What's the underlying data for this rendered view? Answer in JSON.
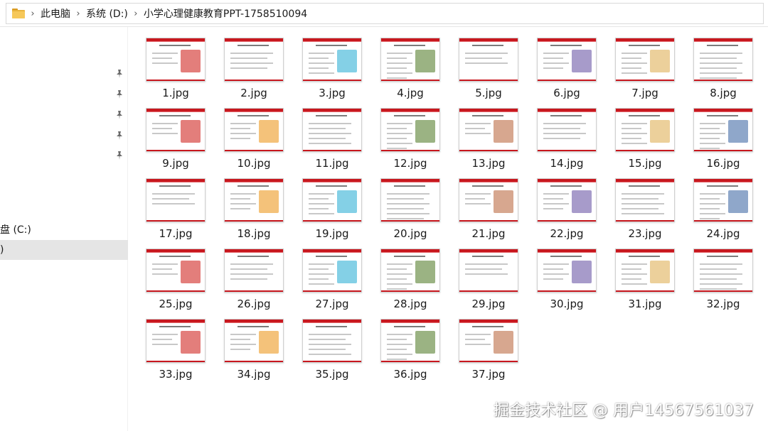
{
  "address_bar": {
    "crumbs": [
      "此电脑",
      "系统 (D:)",
      "小学心理健康教育PPT-1758510094"
    ]
  },
  "sidebar": {
    "drives": [
      {
        "label": "盘 (C:)",
        "selected": false
      },
      {
        "label": ")",
        "selected": true
      }
    ]
  },
  "files": [
    {
      "name": "1.jpg"
    },
    {
      "name": "2.jpg"
    },
    {
      "name": "3.jpg"
    },
    {
      "name": "4.jpg"
    },
    {
      "name": "5.jpg"
    },
    {
      "name": "6.jpg"
    },
    {
      "name": "7.jpg"
    },
    {
      "name": "8.jpg"
    },
    {
      "name": "9.jpg"
    },
    {
      "name": "10.jpg"
    },
    {
      "name": "11.jpg"
    },
    {
      "name": "12.jpg"
    },
    {
      "name": "13.jpg"
    },
    {
      "name": "14.jpg"
    },
    {
      "name": "15.jpg"
    },
    {
      "name": "16.jpg"
    },
    {
      "name": "17.jpg"
    },
    {
      "name": "18.jpg"
    },
    {
      "name": "19.jpg"
    },
    {
      "name": "20.jpg"
    },
    {
      "name": "21.jpg"
    },
    {
      "name": "22.jpg"
    },
    {
      "name": "23.jpg"
    },
    {
      "name": "24.jpg"
    },
    {
      "name": "25.jpg"
    },
    {
      "name": "26.jpg"
    },
    {
      "name": "27.jpg"
    },
    {
      "name": "28.jpg"
    },
    {
      "name": "29.jpg"
    },
    {
      "name": "30.jpg"
    },
    {
      "name": "31.jpg"
    },
    {
      "name": "32.jpg"
    },
    {
      "name": "33.jpg"
    },
    {
      "name": "34.jpg"
    },
    {
      "name": "35.jpg"
    },
    {
      "name": "36.jpg"
    },
    {
      "name": "37.jpg"
    }
  ],
  "watermark": "掘金技术社区 @ 用户14567561037",
  "colors": {
    "slide_accent": "#c8171e",
    "folder": "#f6c85a",
    "selection": "#e5e5e5"
  }
}
